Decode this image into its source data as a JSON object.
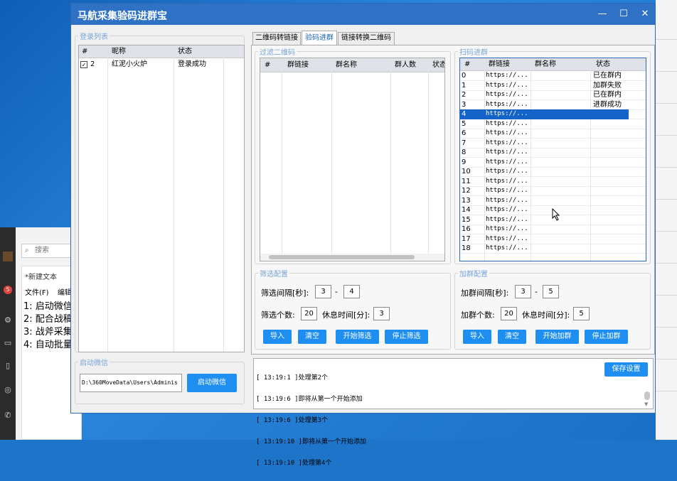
{
  "background": {
    "search_placeholder": "搜索",
    "notepad_title": "*新建文本",
    "notepad_menu": [
      "文件(F)",
      "编辑"
    ],
    "notepad_lines": [
      "1: 启动微信",
      "2: 配合战稿",
      "3: 战斧采集",
      "4: 自动批量"
    ],
    "badge": "5"
  },
  "window": {
    "title": "马航采集验码进群宝",
    "min_icon": "minimize-icon",
    "max_icon": "maximize-icon",
    "close_icon": "close-icon"
  },
  "login_group": {
    "legend": "登录列表",
    "columns": [
      "#",
      "昵称",
      "状态"
    ],
    "rows": [
      {
        "num": "2",
        "checked": true,
        "nickname": "红泥小火炉",
        "status": "登录成功"
      }
    ]
  },
  "start_group": {
    "legend": "启动微信",
    "path": "D:\\360MoveData\\Users\\Adminis",
    "button": "启动微信"
  },
  "tabs": [
    {
      "label": "二维码转链接"
    },
    {
      "label": "验码进群",
      "selected": true
    },
    {
      "label": "链接转换二维码"
    }
  ],
  "filter_group": {
    "legend": "过滤二维码",
    "columns": [
      "#",
      "群链接",
      "群名称",
      "群人数",
      "状态"
    ]
  },
  "scan_group": {
    "legend": "扫码进群",
    "columns": [
      "#",
      "群链接",
      "群名称",
      "状态"
    ],
    "rows": [
      {
        "num": "0",
        "link": "https://...",
        "status": "已在群内"
      },
      {
        "num": "1",
        "link": "https://...",
        "status": "加群失败"
      },
      {
        "num": "2",
        "link": "https://...",
        "status": "已在群内"
      },
      {
        "num": "3",
        "link": "https://...",
        "status": "进群成功"
      },
      {
        "num": "4",
        "link": "https://...",
        "status": "",
        "selected": true
      },
      {
        "num": "5",
        "link": "https://...",
        "status": ""
      },
      {
        "num": "6",
        "link": "https://...",
        "status": ""
      },
      {
        "num": "7",
        "link": "https://...",
        "status": ""
      },
      {
        "num": "8",
        "link": "https://...",
        "status": ""
      },
      {
        "num": "9",
        "link": "https://...",
        "status": ""
      },
      {
        "num": "10",
        "link": "https://...",
        "status": ""
      },
      {
        "num": "11",
        "link": "https://...",
        "status": ""
      },
      {
        "num": "12",
        "link": "https://...",
        "status": ""
      },
      {
        "num": "13",
        "link": "https://...",
        "status": ""
      },
      {
        "num": "14",
        "link": "https://...",
        "status": ""
      },
      {
        "num": "15",
        "link": "https://...",
        "status": ""
      },
      {
        "num": "16",
        "link": "https://...",
        "status": ""
      },
      {
        "num": "17",
        "link": "https://...",
        "status": ""
      },
      {
        "num": "18",
        "link": "https://...",
        "status": ""
      }
    ]
  },
  "filter_config": {
    "legend": "筛选配置",
    "interval_label": "筛选间隔[秒]:",
    "interval_min": "3",
    "dash": "-",
    "interval_max": "4",
    "count_label": "筛选个数:",
    "count": "20",
    "rest_label": "休息时间[分]:",
    "rest": "3",
    "buttons": [
      "导入",
      "清空",
      "开始筛选",
      "停止筛选"
    ]
  },
  "join_config": {
    "legend": "加群配置",
    "interval_label": "加群间隔[秒]:",
    "interval_min": "3",
    "dash": "-",
    "interval_max": "5",
    "count_label": "加群个数:",
    "count": "20",
    "rest_label": "休息时间[分]:",
    "rest": "5",
    "buttons": [
      "导入",
      "清空",
      "开始加群",
      "停止加群"
    ]
  },
  "log": {
    "lines": [
      "[ 13:19:1 ]处理第2个",
      "[ 13:19:6 ]即将从第一个开始添加",
      "[ 13:19:6 ]处理第3个",
      "[ 13:19:10 ]即将从第一个开始添加",
      "[ 13:19:10 ]处理第4个"
    ],
    "save_button": "保存设置"
  },
  "colors": {
    "titlebar": "#2f72c5",
    "button": "#1e8ff0",
    "selection": "#1464c8",
    "legend": "#7aa5d6"
  }
}
